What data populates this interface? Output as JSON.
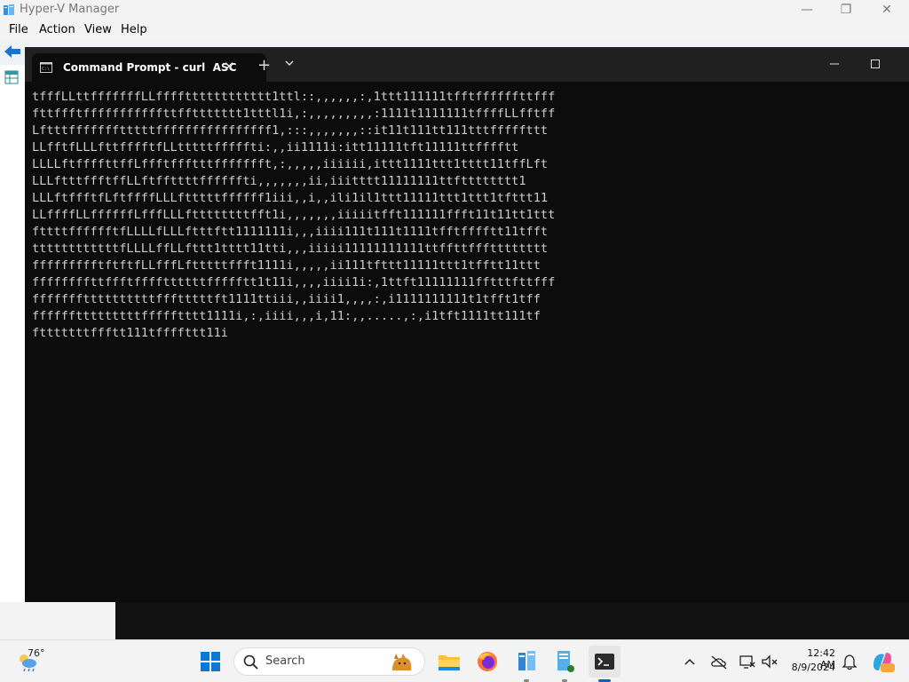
{
  "hyperv": {
    "title": "Hyper-V Manager",
    "menu": [
      "File",
      "Action",
      "View",
      "Help"
    ],
    "minimize_glyph": "—",
    "restore_glyph": "❐",
    "close_glyph": "✕"
  },
  "terminal": {
    "tab_title": "Command Prompt - curl  ASC",
    "close_tab_glyph": "✕",
    "new_tab_glyph": "+",
    "lines": [
      "tfffLLttfffffffLLfffftttttttttttt1ttl::,,,,,,:,1ttt111111tfftffffffttfff",
      "fttffftfffffffffffttffttttttt1tttl1i,:,,,,,,,,,:1111t1111111tffffLLfftff",
      "Lftttffffffftttttffffffffffffffff1,:::,,,,,,,::it11t111tt111tttfffffttt",
      "LLfftfLLLfttfffftfLLtttttfffffti:,,ii1111i:itt11111tft11111ttfffftt",
      "LLLLftffffttffLffftffftttffffffft,:,,,,,iiiiii,ittt1111ttt1tttt11tffLft",
      "LLLftttffftffLLftffttttffffffti,,,,,,,ii,iiitttt11111111ttftttttttt1",
      "LLLftffftfLftffffLLLftttttffffff1iii,,i,,ili1il1ttt11111ttt1ttt1tfttt11",
      "LLffffLLffffffLfffLLLfttttttttfft1i,,,,,,,iiiiitfft111111ffft11t11tt1ttt",
      "fttttfffffftfLLLLfLLLftttftt1111111i,,,iiii111t111t1111tfftfffftt11tfft",
      "ttttttttttttfLLLLffLLfttt1tttt11tti,,,iiiii11111111111ttffttffftttttttt",
      "ffffffffftftftfLLfffLftttttffft1111i,,,,,ii111tfttt11111ttt1tfftt11ttt",
      "ffffffffttffftffffttttttffffftt1t11i,,,,iiii1i:,1ttft11111111fftttfttfff",
      "fffffffttttttttttffftttttft1111ttiii,,iiii1,,,,:,i1111111111t1tfft1tff",
      "fffffftttttttttffffftttt1111i,:,iiii,,,i,11:,,.....,:,i1tft1111tt111tf",
      "ftttttttffftt111tffffttt11i"
    ]
  },
  "taskbar": {
    "weather_temp": "76°",
    "search_placeholder": "Search",
    "clock_time": "12:42 AM",
    "clock_date": "8/9/2024"
  },
  "colors": {
    "terminal_bg": "#0c0c0c",
    "terminal_text": "#cccccc",
    "accent": "#0067c0"
  }
}
